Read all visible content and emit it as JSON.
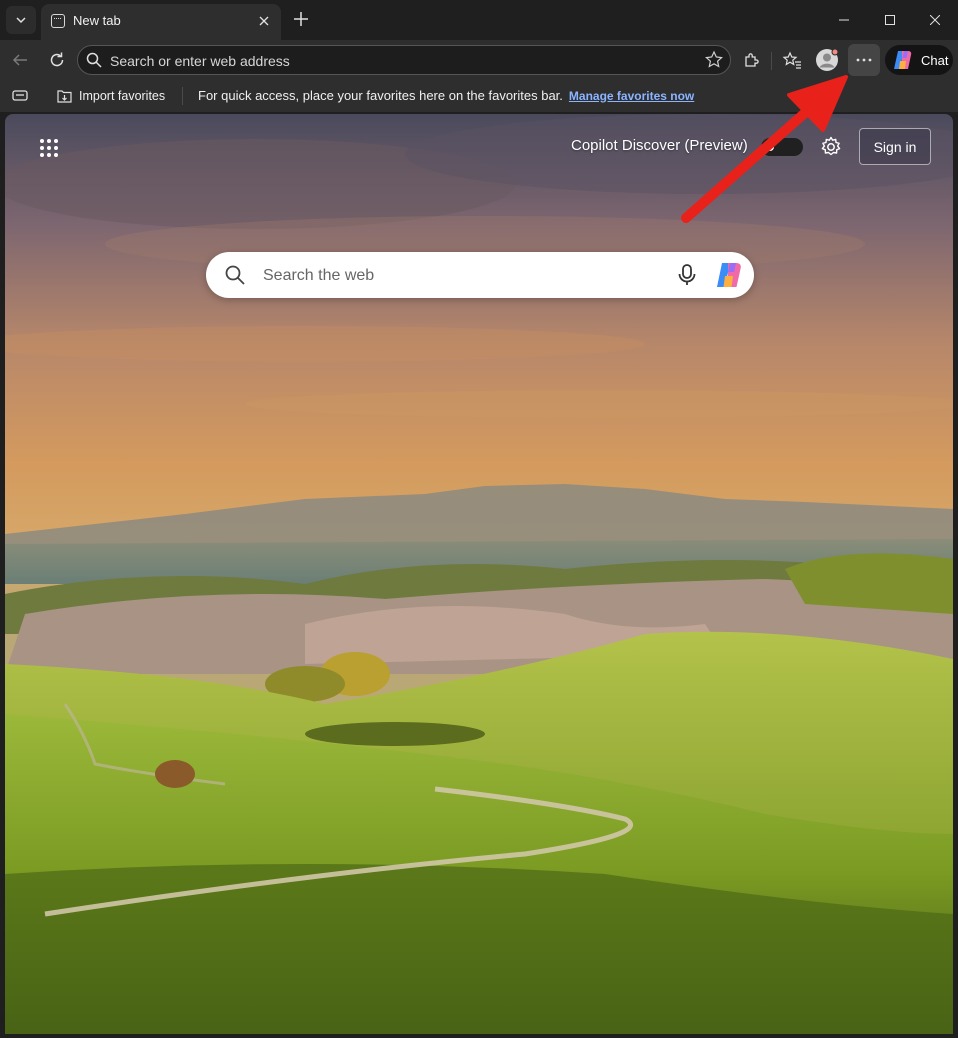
{
  "tab": {
    "title": "New tab",
    "close_icon": "close-icon"
  },
  "window_controls": {
    "minimize_icon": "minimize-icon",
    "maximize_icon": "maximize-icon",
    "close_icon": "close-icon"
  },
  "address_bar": {
    "placeholder": "Search or enter web address"
  },
  "toolbar": {
    "chat_label": "Chat"
  },
  "favorites_bar": {
    "import_label": "Import favorites",
    "message": "For quick access, place your favorites here on the favorites bar.",
    "manage_link": "Manage favorites now"
  },
  "new_tab_page": {
    "discover_label": "Copilot Discover (Preview)",
    "discover_toggle_on": false,
    "sign_in_label": "Sign in",
    "search_placeholder": "Search the web"
  },
  "colors": {
    "annotation_arrow": "#e8221b",
    "link": "#8cb4ff",
    "more_button_bg": "#454545"
  }
}
